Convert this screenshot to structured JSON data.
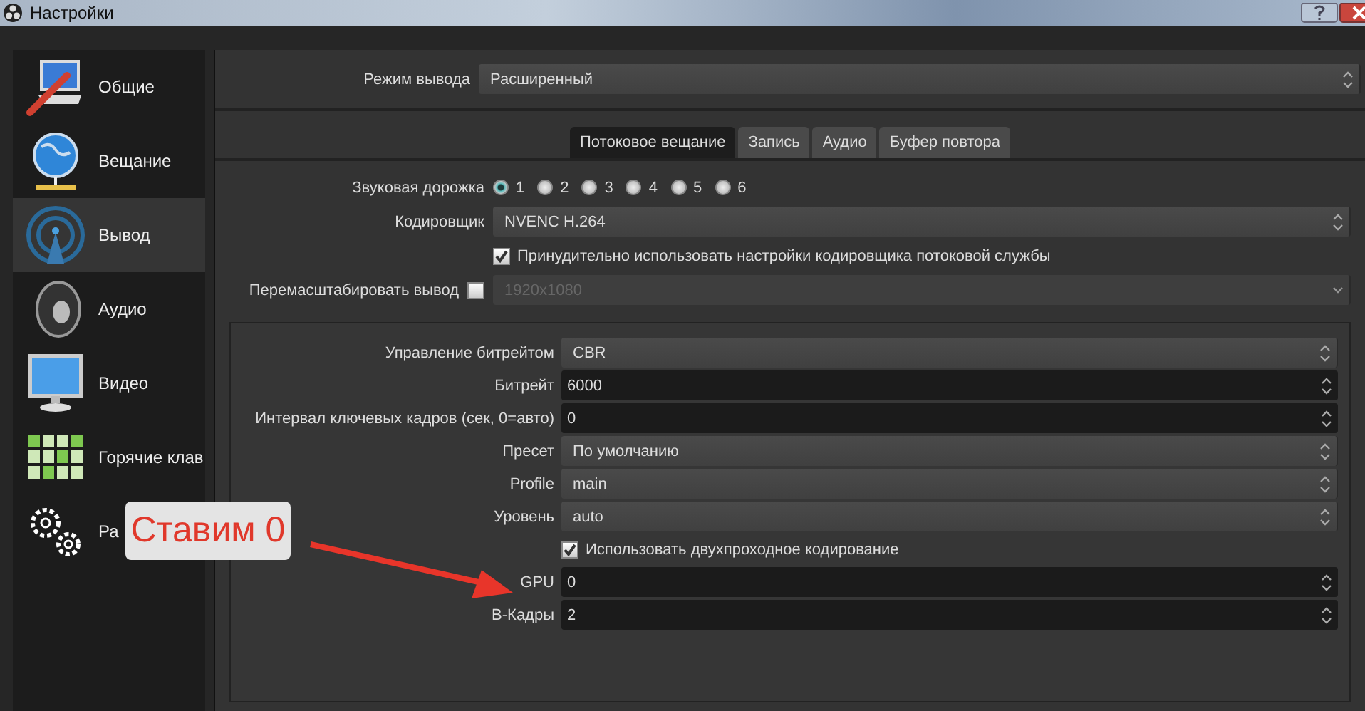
{
  "window": {
    "title": "Настройки"
  },
  "sidebar": {
    "items": [
      {
        "label": "Общие",
        "selected": false
      },
      {
        "label": "Вещание",
        "selected": false
      },
      {
        "label": "Вывод",
        "selected": true
      },
      {
        "label": "Аудио",
        "selected": false
      },
      {
        "label": "Видео",
        "selected": false
      },
      {
        "label": "Горячие клав",
        "selected": false
      },
      {
        "label": "Ра",
        "selected": false
      }
    ]
  },
  "output_mode": {
    "label": "Режим вывода",
    "value": "Расширенный"
  },
  "tabs": [
    {
      "label": "Потоковое вещание",
      "selected": true
    },
    {
      "label": "Запись",
      "selected": false
    },
    {
      "label": "Аудио",
      "selected": false
    },
    {
      "label": "Буфер повтора",
      "selected": false
    }
  ],
  "audio_track": {
    "label": "Звуковая дорожка",
    "options": [
      {
        "label": "1",
        "selected": true
      },
      {
        "label": "2",
        "selected": false
      },
      {
        "label": "3",
        "selected": false
      },
      {
        "label": "4",
        "selected": false
      },
      {
        "label": "5",
        "selected": false
      },
      {
        "label": "6",
        "selected": false
      }
    ]
  },
  "encoder": {
    "label": "Кодировщик",
    "value": "NVENC H.264"
  },
  "enforce_settings": {
    "label": "Принудительно использовать настройки кодировщика потоковой службы",
    "checked": true
  },
  "rescale": {
    "label": "Перемасштабировать вывод",
    "checked": false,
    "value": "1920x1080"
  },
  "encoder_settings": [
    {
      "kind": "select",
      "label": "Управление битрейтом",
      "value": "CBR"
    },
    {
      "kind": "spin",
      "label": "Битрейт",
      "value": "6000"
    },
    {
      "kind": "spin",
      "label": "Интервал ключевых кадров (сек, 0=авто)",
      "value": "0"
    },
    {
      "kind": "select",
      "label": "Пресет",
      "value": "По умолчанию"
    },
    {
      "kind": "select",
      "label": "Profile",
      "value": "main"
    },
    {
      "kind": "select",
      "label": "Уровень",
      "value": "auto"
    },
    {
      "kind": "checkbox",
      "label": "Использовать двухпроходное кодирование",
      "checked": true
    },
    {
      "kind": "spin",
      "label": "GPU",
      "value": "0"
    },
    {
      "kind": "spin",
      "label": "B-Кадры",
      "value": "2"
    }
  ],
  "annotation": {
    "text": "Ставим 0"
  }
}
